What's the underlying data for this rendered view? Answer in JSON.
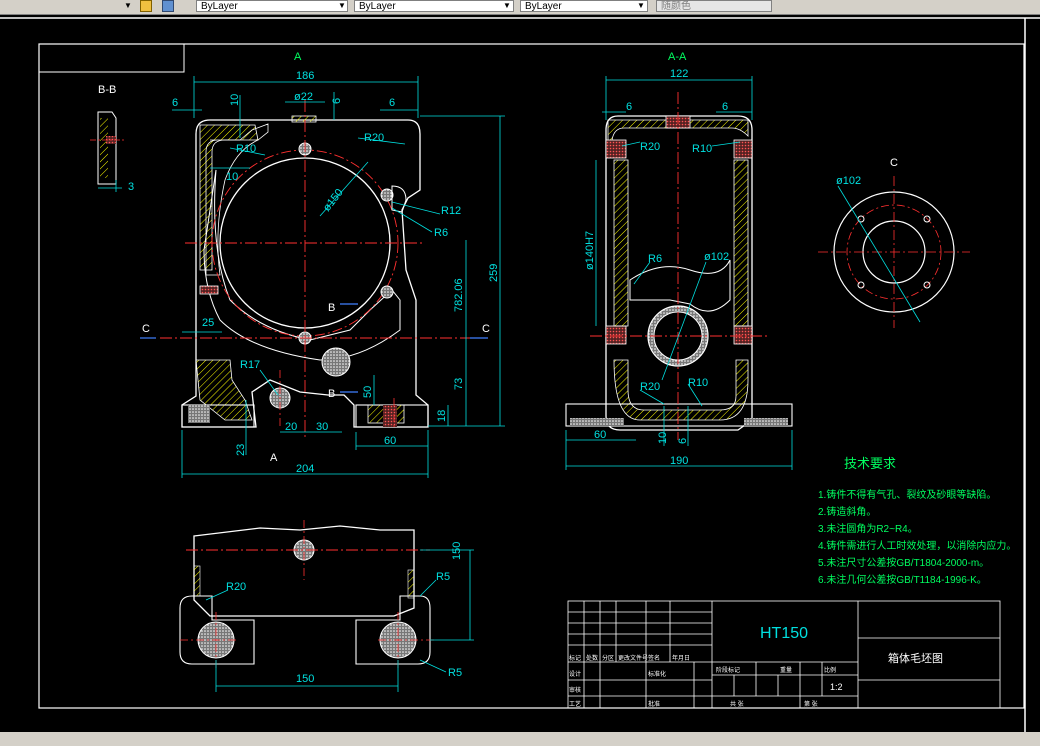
{
  "toolbar": {
    "color_control": "ByLayer",
    "linetype_control": "ByLayer",
    "lineweight_control": "ByLayer",
    "plotstyle_control": "随颜色"
  },
  "views": {
    "main": {
      "label": "A"
    },
    "section_aa": {
      "label": "A-A"
    },
    "section_bb": {
      "label": "B-B"
    },
    "view_c": {
      "label": "C"
    }
  },
  "dims_main": {
    "w186": "186",
    "d22": "ø22",
    "six_a": "6",
    "six_b": "6",
    "six_c": "6",
    "ten_a": "10",
    "ten_b": "10",
    "r10": "R10",
    "r20": "R20",
    "d150": "ø150",
    "r12": "R12",
    "r6": "R6",
    "v78206": "782.06",
    "h259": "259",
    "h25": "25",
    "r17": "R17",
    "h50": "50",
    "h73": "73",
    "h18": "18",
    "h20": "20",
    "h30": "30",
    "h60": "60",
    "h23": "23",
    "w204": "204",
    "b": "B",
    "c": "C",
    "a": "A"
  },
  "dims_aa": {
    "w122": "122",
    "six_a": "6",
    "six_b": "6",
    "r20": "R20",
    "r10": "R10",
    "d140": "ø140H7",
    "r6": "R6",
    "d102": "ø102",
    "r20b": "R20",
    "r10b": "R10",
    "h60": "60",
    "ten": "10",
    "six": "6",
    "w190": "190"
  },
  "dims_c": {
    "d102": "ø102"
  },
  "dims_bb": {
    "three": "3"
  },
  "dims_top": {
    "h150": "150",
    "r5a": "R5",
    "r20": "R20",
    "r5b": "R5",
    "w150": "150"
  },
  "tech": {
    "title": "技术要求",
    "items": [
      "1.铸件不得有气孔、裂纹及砂眼等缺陷。",
      "2.铸造斜角。",
      "3.未注圆角为R2~R4。",
      "4.铸件需进行人工时效处理，以消除内应力。",
      "5.未注尺寸公差按GB/T1804-2000-m。",
      "6.未注几何公差按GB/T1184-1996-K。"
    ]
  },
  "title_block": {
    "material": "HT150",
    "name": "箱体毛坯图",
    "scale": "1:2",
    "r_mark": "标记",
    "r_count": "处数",
    "r_zone": "分区",
    "r_change": "更改文件号",
    "r_sign": "签名",
    "r_date": "年月日",
    "designer": "设计",
    "std": "标准化",
    "stage": "阶段标记",
    "weight": "重量",
    "ratio": "比例",
    "review": "审核",
    "craft": "工艺",
    "approve": "批准",
    "total": "共 张",
    "sheet": "第 张"
  }
}
